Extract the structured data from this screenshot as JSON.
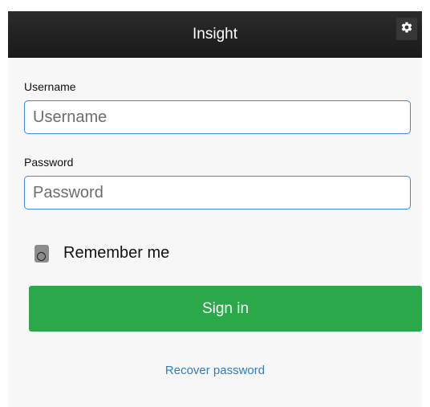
{
  "header": {
    "title": "Insight",
    "settings_icon": "gear-icon"
  },
  "form": {
    "username_label": "Username",
    "username_placeholder": "Username",
    "password_label": "Password",
    "password_placeholder": "Password",
    "remember_label": "Remember me",
    "signin_label": "Sign in",
    "recover_label": "Recover password"
  },
  "colors": {
    "header_bg": "#1f1f1f",
    "accent_blue": "#3d8bd8",
    "signin_green": "#2aa84a",
    "link_blue": "#2f7cc4"
  }
}
